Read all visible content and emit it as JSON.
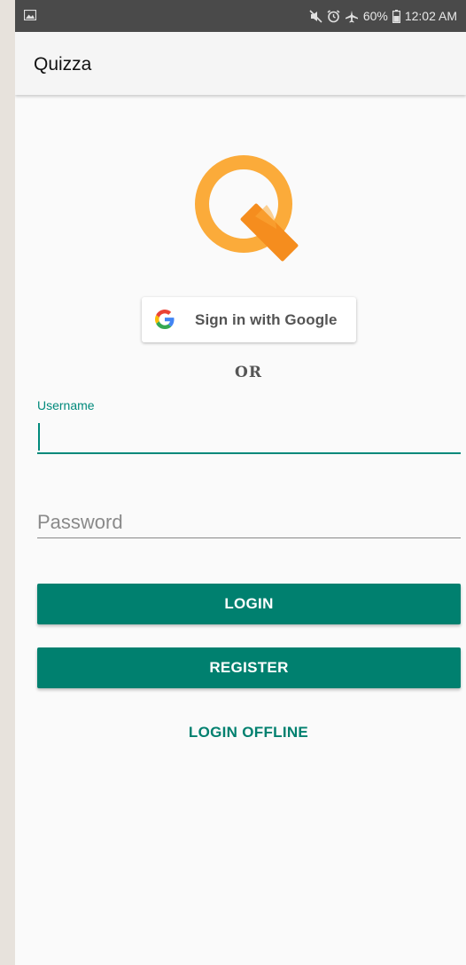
{
  "status_bar": {
    "battery": "60%",
    "time": "12:02 AM",
    "icons": [
      "gallery-icon",
      "mute-icon",
      "alarm-icon",
      "airplane-icon",
      "battery-icon"
    ]
  },
  "app_bar": {
    "title": "Quizza"
  },
  "logo": {
    "icon": "quizza-q-logo",
    "colors": {
      "ring": "#fbab3a",
      "stroke": "#f58d1e"
    }
  },
  "google": {
    "label": "Sign in with Google",
    "icon": "google-g-icon"
  },
  "divider_text": "OR",
  "username": {
    "label": "Username",
    "value": ""
  },
  "password": {
    "placeholder": "Password",
    "value": ""
  },
  "buttons": {
    "login": "LOGIN",
    "register": "REGISTER",
    "login_offline": "LOGIN OFFLINE"
  },
  "colors": {
    "accent": "#00806f",
    "status_bar": "#4a4a4a",
    "background": "#fafafa"
  }
}
